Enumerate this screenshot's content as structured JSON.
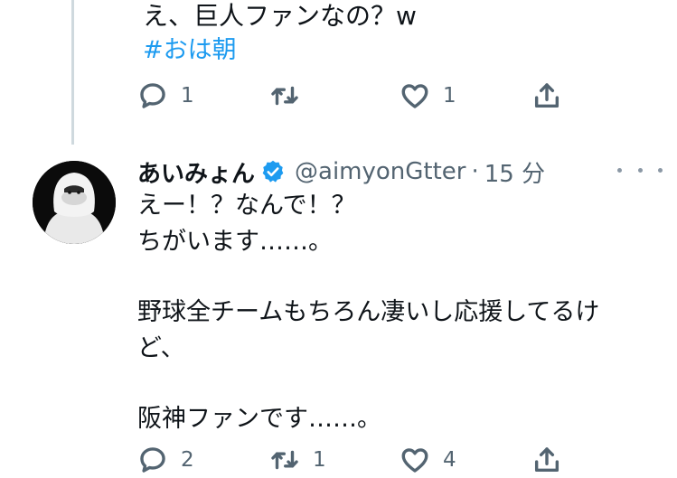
{
  "previous_tweet": {
    "text": "え、巨人ファンなの？w",
    "hashtag": "#おは朝",
    "actions": {
      "reply_count": "1",
      "retweet_count": "",
      "like_count": "1"
    }
  },
  "tweet": {
    "display_name": "あいみょん",
    "handle": "@aimyonGtter",
    "separator": "·",
    "time": "15 分",
    "lines": [
      "えー！？なんで！？",
      "ちがいます……。",
      "",
      "野球全チームもちろん凄いし応援してるけ",
      "ど、",
      "",
      "阪神ファンです……。"
    ],
    "actions": {
      "reply_count": "2",
      "retweet_count": "1",
      "like_count": "4"
    }
  },
  "icons": [
    "reply-icon",
    "retweet-icon",
    "like-icon",
    "share-icon",
    "verified-badge-icon",
    "more-options-icon"
  ],
  "colors": {
    "link": "#1d9bf0",
    "muted": "#536471",
    "thread_line": "#cfd9de",
    "verified": "#1d9bf0"
  }
}
